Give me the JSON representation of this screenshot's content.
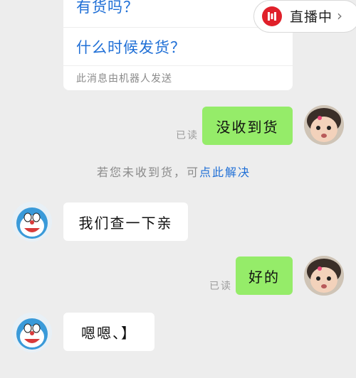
{
  "faq_card": {
    "questions": [
      "有货吗？",
      "什么时候发货？"
    ],
    "footnote": "此消息由机器人发送"
  },
  "live_badge": {
    "icon": "live-stream-icon",
    "label": "直播中",
    "chevron": "›"
  },
  "messages": [
    {
      "from": "me",
      "text": "没收到货",
      "read": "已读"
    },
    {
      "from": "them",
      "text": "我们查一下亲"
    },
    {
      "from": "me",
      "text": "好的",
      "read": "已读"
    },
    {
      "from": "them",
      "text": "嗯嗯、】"
    }
  ],
  "notice": {
    "text": "若您未收到货，可",
    "link": "点此解决"
  },
  "colors": {
    "background": "#ededed",
    "my_bubble": "#95ec69",
    "their_bubble": "#ffffff",
    "link": "#1f6fd6",
    "live_red": "#e0202a"
  }
}
